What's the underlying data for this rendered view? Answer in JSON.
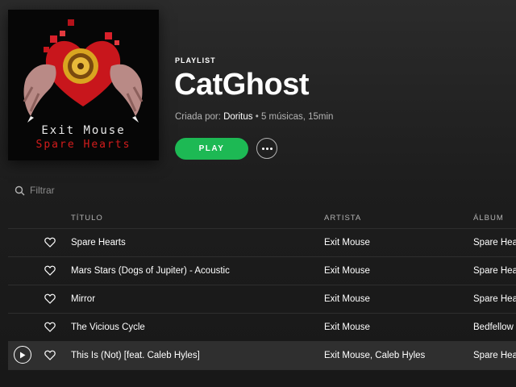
{
  "playlist": {
    "cover": {
      "line1": "Exit Mouse",
      "line2": "Spare Hearts"
    },
    "kind": "PLAYLIST",
    "title": "CatGhost",
    "created_by_label": "Criada por:",
    "owner": "Doritus",
    "stats": "• 5 músicas, 15min",
    "play_label": "PLAY"
  },
  "filter": {
    "placeholder": "Filtrar",
    "icon": "search-icon"
  },
  "columns": {
    "title": "TÍTULO",
    "artist": "ARTISTA",
    "album": "ÁLBUM"
  },
  "tracks": [
    {
      "title": "Spare Hearts",
      "artist": "Exit Mouse",
      "album": "Spare Hea"
    },
    {
      "title": "Mars Stars (Dogs of Jupiter) - Acoustic",
      "artist": "Exit Mouse",
      "album": "Spare Hea"
    },
    {
      "title": "Mirror",
      "artist": "Exit Mouse",
      "album": "Spare Hea"
    },
    {
      "title": "The Vicious Cycle",
      "artist": "Exit Mouse",
      "album": "Bedfellow"
    },
    {
      "title": "This Is (Not) [feat. Caleb Hyles]",
      "artist": "Exit Mouse, Caleb Hyles",
      "album": "Spare Hea"
    }
  ],
  "colors": {
    "accent": "#1db954",
    "background": "#181818",
    "row_selected": "#2f2f2f",
    "muted_text": "#b3b3b3"
  }
}
